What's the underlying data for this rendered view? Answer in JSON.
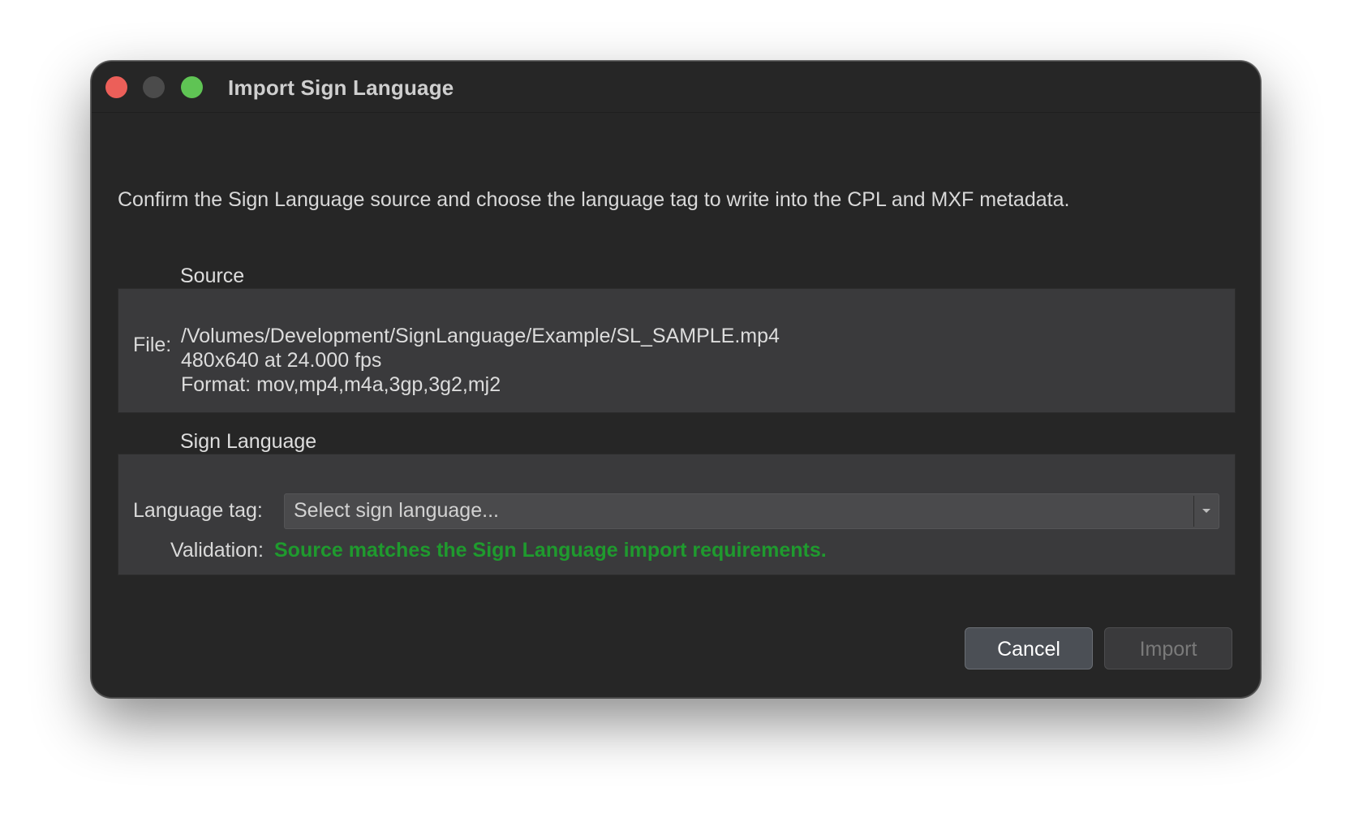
{
  "window": {
    "title": "Import Sign Language"
  },
  "instructions": "Confirm the Sign Language source and choose the language tag to write into the CPL and MXF metadata.",
  "source": {
    "group_label": "Source",
    "file_label": "File:",
    "file_path": "/Volumes/Development/SignLanguage/Example/SL_SAMPLE.mp4",
    "resolution": "480x640 at 24.000 fps",
    "format": "Format: mov,mp4,m4a,3gp,3g2,mj2"
  },
  "sign_language": {
    "group_label": "Sign Language",
    "language_tag_label": "Language tag:",
    "language_tag_placeholder": "Select sign language...",
    "validation_label": "Validation:",
    "validation_message": "Source matches the Sign Language import requirements.",
    "validation_color": "#1f9a2e"
  },
  "buttons": {
    "cancel": "Cancel",
    "import": "Import"
  },
  "icons": {
    "close": "close-traffic-light",
    "minimize": "minimize-traffic-light",
    "zoom": "zoom-traffic-light",
    "dropdown": "chevron-down-icon"
  }
}
